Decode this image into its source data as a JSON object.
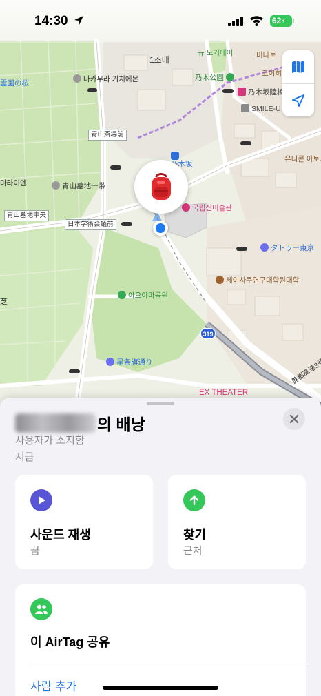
{
  "status_bar": {
    "time": "14:30",
    "battery": "62"
  },
  "map": {
    "labels": {
      "gyu_nogizaka": "규 노기테이",
      "minato": "미나토",
      "koihi": "코이히",
      "chome1": "1조메",
      "nakamura": "나카무라 기치에몬",
      "nogi_park": "乃木公園",
      "nogizaka_rikkyo": "乃木坂陸橋",
      "smile": "SMILE-U",
      "aoyama_saijo": "青山斎場前",
      "nogizaka": "乃木坂",
      "unicorn": "유니콘 아토키",
      "aoyama_bochi_ittai": "青山墓地一帯",
      "maraien": "마라이엔",
      "national_art_center": "국립신미술관",
      "aoyama_bochi_chuo": "青山墓地中央",
      "nihon_gakujutsu": "日本学術会議前",
      "tower_tokyo": "タトゥー東京",
      "gyo_no_sakura": "霊園の桜",
      "research_univ": "세이사쿠연구대학원대학",
      "aoyama_park": "아오야마공원",
      "seijoki_dori": "星条旗通り",
      "shutoko": "首都高速3号",
      "route_319": "319",
      "ex_theater": "EX THEATER",
      "chi": "芝"
    }
  },
  "sheet": {
    "item_title_suffix": "의 배낭",
    "owner_text": "사용자가 소지함",
    "time_text": "지금",
    "play_sound": {
      "title": "사운드 재생",
      "subtitle": "끔"
    },
    "find": {
      "title": "찾기",
      "subtitle": "근처"
    },
    "share": {
      "title": "이 AirTag 공유",
      "add_person": "사람 추가"
    }
  },
  "colors": {
    "accent_blue": "#1f76e8",
    "play_purple": "#5856d6",
    "find_green": "#34c759",
    "share_green": "#34c759"
  },
  "icons": {
    "pin": "backpack-icon",
    "map_mode": "map-icon",
    "locate": "location-arrow-icon",
    "close": "close-icon",
    "play_sound": "play-icon",
    "find": "arrow-up-icon",
    "share": "people-icon"
  }
}
